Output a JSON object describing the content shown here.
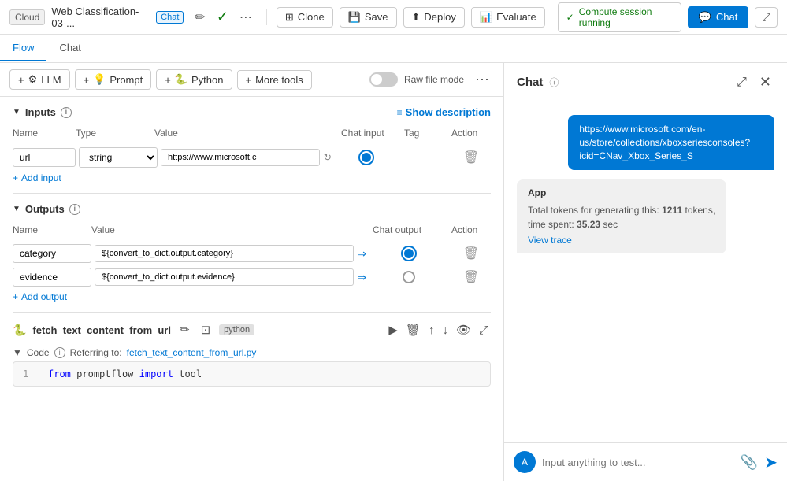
{
  "topbar": {
    "cloud_label": "Cloud",
    "title": "Web Classification-03-...",
    "chat_badge": "Chat",
    "more_icon": "⋯",
    "clone_label": "Clone",
    "save_label": "Save",
    "deploy_label": "Deploy",
    "evaluate_label": "Evaluate",
    "compute_label": "Compute session running",
    "chat_button": "Chat",
    "expand_icon": "⤢"
  },
  "tabs": [
    {
      "label": "Flow",
      "active": true
    },
    {
      "label": "Chat",
      "active": false
    }
  ],
  "toolbar": {
    "llm_label": "LLM",
    "prompt_label": "Prompt",
    "python_label": "Python",
    "more_tools_label": "More tools",
    "raw_file_label": "Raw file mode",
    "plus_icon": "+"
  },
  "inputs": {
    "title": "Inputs",
    "show_description_label": "Show description",
    "columns": [
      "Name",
      "Type",
      "Value",
      "Chat input",
      "Tag",
      "Action"
    ],
    "rows": [
      {
        "name": "url",
        "type": "string",
        "value": "https://www.microsoft.c",
        "chat_input": true,
        "tag": ""
      }
    ],
    "add_input_label": "Add input"
  },
  "outputs": {
    "title": "Outputs",
    "columns": [
      "Name",
      "Value",
      "Chat output",
      "Action"
    ],
    "rows": [
      {
        "name": "category",
        "value": "${convert_to_dict.output.category}",
        "chat_output": true
      },
      {
        "name": "evidence",
        "value": "${convert_to_dict.output.evidence}",
        "chat_output": false
      }
    ],
    "add_output_label": "Add output"
  },
  "code_block": {
    "icon": "🐍",
    "title": "fetch_text_content_from_url",
    "badge": "python",
    "code_label": "Code",
    "referring_label": "Referring to:",
    "referring_file": "fetch_text_content_from_url.py",
    "line_number": "1",
    "code_text": "from promptflow import tool"
  },
  "chat": {
    "title": "Chat",
    "user_message": "https://www.microsoft.com/en-us/store/collections/xboxseriesconsoles?icid=CNav_Xbox_Series_S",
    "app_label": "App",
    "tokens_text": "Total tokens for generating this: ",
    "tokens_value": "1211",
    "tokens_unit": " tokens,",
    "time_text": "time spent: ",
    "time_value": "35.23",
    "time_unit": " sec",
    "view_trace_label": "View trace",
    "input_placeholder": "Input anything to test...",
    "avatar_initials": "A"
  },
  "icons": {
    "check": "✓",
    "delete": "🗑",
    "pencil": "✏",
    "run": "▶",
    "copy": "⊡",
    "expand": "⤢",
    "settings": "⚙",
    "arrow_up": "↑",
    "arrow_down": "↓",
    "eye": "👁",
    "info": "i",
    "send": "➤",
    "attach": "📎",
    "lines": "≡"
  }
}
